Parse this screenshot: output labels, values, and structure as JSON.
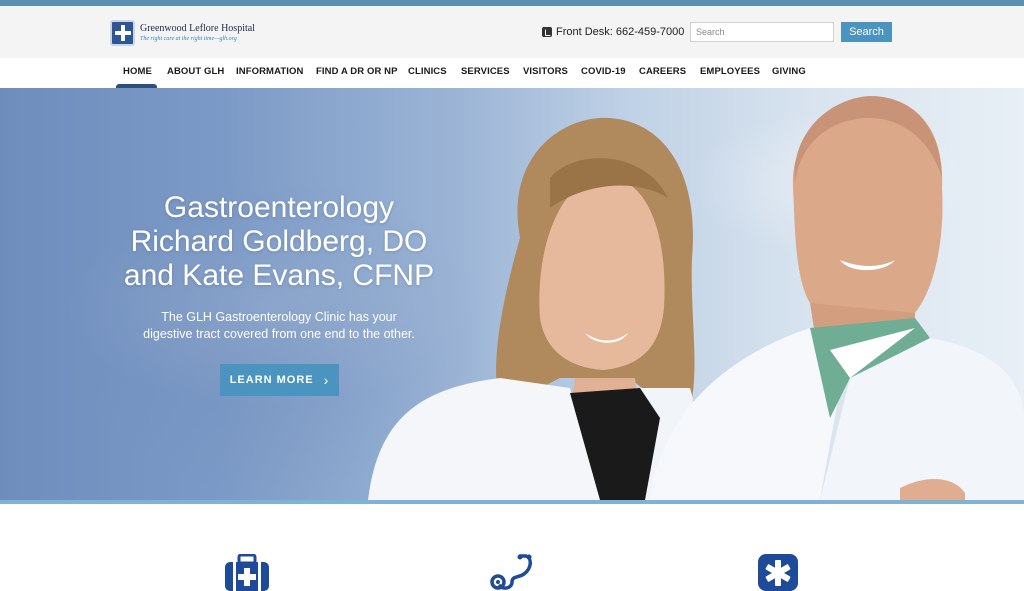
{
  "header": {
    "logo": {
      "name": "Greenwood Leflore Hospital",
      "tagline": "The right care at the right time—glh.org"
    },
    "front_desk": "Front Desk: 662-459-7000",
    "search": {
      "placeholder": "Search",
      "button_label": "Search"
    }
  },
  "nav": {
    "active": "HOME",
    "items": [
      "HOME",
      "ABOUT GLH",
      "INFORMATION",
      "FIND A DR OR NP",
      "CLINICS",
      "SERVICES",
      "VISITORS",
      "COVID-19",
      "CAREERS",
      "EMPLOYEES",
      "GIVING"
    ]
  },
  "hero": {
    "title_lines": [
      "Gastroenterology",
      "Richard Goldberg, DO",
      "and Kate Evans, CFNP"
    ],
    "subtitle_lines": [
      "The GLH Gastroenterology Clinic has your",
      "digestive tract covered from one end to the other."
    ],
    "cta_label": "LEARN MORE",
    "people": [
      "woman-clinician-photo",
      "man-physician-photo"
    ]
  },
  "features": {
    "icons": [
      "medical-kit-icon",
      "stethoscope-icon",
      "star-of-life-icon"
    ]
  },
  "colors": {
    "accent": "#4b94bf",
    "nav_active": "#2d4f7c",
    "brand_blue": "#2f5597",
    "icon_blue": "#1e4a9a"
  }
}
